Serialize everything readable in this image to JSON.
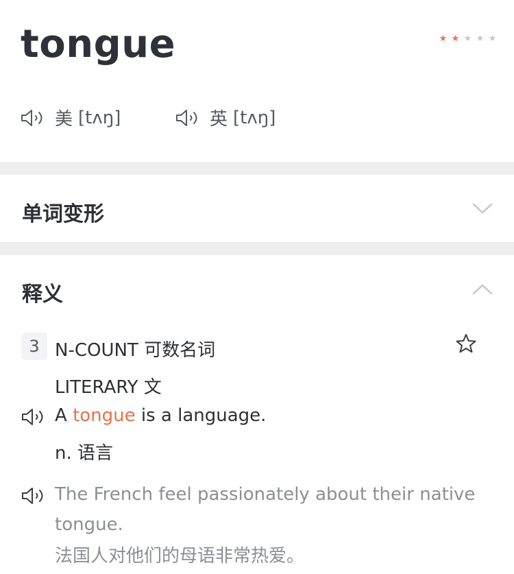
{
  "word": {
    "headword": "tongue",
    "difficulty_stars": {
      "filled": 2,
      "total": 5,
      "filled_color": "#e8714a",
      "empty_color": "#c8c8c8"
    },
    "pronunciations": [
      {
        "region": "美",
        "ipa": "[tʌŋ]"
      },
      {
        "region": "英",
        "ipa": "[tʌŋ]"
      }
    ]
  },
  "sections": {
    "inflections": {
      "title": "单词变形",
      "expanded": false
    },
    "definitions": {
      "title": "释义",
      "expanded": true
    }
  },
  "sense": {
    "number": "3",
    "grammar": "N-COUNT 可数名词",
    "register": "LITERARY 文",
    "definition": {
      "before": "A ",
      "highlight": "tongue",
      "after": " is a language."
    },
    "translation": "n. 语言",
    "example": {
      "en": "The French feel passionately about their native tongue.",
      "zh": "法国人对他们的母语非常热爱。"
    }
  },
  "icons": {
    "speaker": "speaker-icon",
    "chevron_down": "chevron-down-icon",
    "chevron_up": "chevron-up-icon",
    "favorite": "star-outline-icon"
  }
}
